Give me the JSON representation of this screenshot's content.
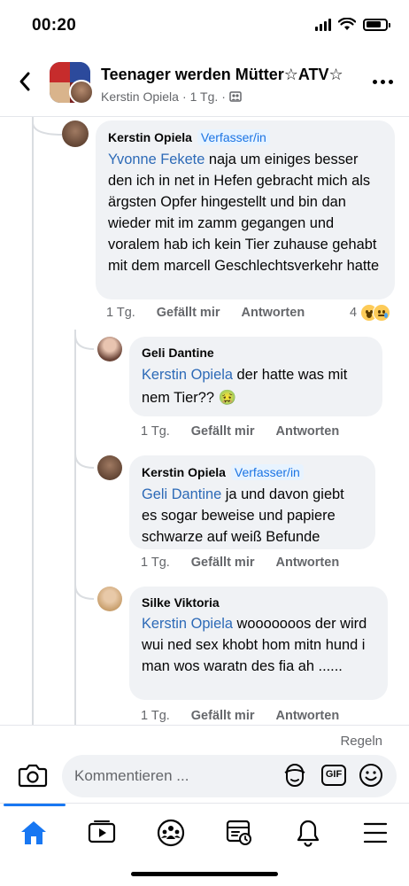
{
  "status_bar": {
    "time": "00:20"
  },
  "header": {
    "group_title": "Teenager werden Mütter☆ATV☆",
    "poster_name": "Kerstin Opiela",
    "post_age": "1 Tg."
  },
  "comments": [
    {
      "author": "Kerstin Opiela",
      "badge": "Verfasser/in",
      "mention": "Yvonne Fekete",
      "text": " naja um einiges besser den ich in net in Hefen gebracht mich als ärgsten Opfer hingestellt und bin dan wieder mit im zamm gegangen und voralem hab ich kein Tier zuhause gehabt mit dem marcell Geschlechtsverkehr hatte",
      "time": "1 Tg.",
      "like": "Gefällt mir",
      "reply": "Antworten",
      "reaction_count": "4",
      "reaction_icons": [
        "wow-reaction-icon",
        "sad-reaction-icon"
      ]
    },
    {
      "author": "Geli Dantine",
      "mention": "Kerstin Opiela",
      "text": " der hatte was mit nem Tier?? 🤢",
      "time": "1 Tg.",
      "like": "Gefällt mir",
      "reply": "Antworten"
    },
    {
      "author": "Kerstin Opiela",
      "badge": "Verfasser/in",
      "mention": "Geli Dantine",
      "text": " ja und davon giebt es sogar beweise und papiere schwarze auf weiß Befunde",
      "time": "1 Tg.",
      "like": "Gefällt mir",
      "reply": "Antworten"
    },
    {
      "author": "Silke Viktoria",
      "mention": "Kerstin Opiela",
      "text": " wooooooos der wird wui ned sex khobt hom mitn hund i man wos waratn des fia ah ......",
      "time": "1 Tg.",
      "like": "Gefällt mir",
      "reply": "Antworten"
    }
  ],
  "footer": {
    "rules_label": "Regeln",
    "comment_placeholder": "Kommentieren ...",
    "gif_label": "GIF"
  },
  "tabs": [
    "home-icon",
    "video-icon",
    "groups-icon",
    "feeds-icon",
    "notifications-icon",
    "menu-icon"
  ],
  "colors": {
    "accent": "#1877f2",
    "mention": "#2d6ab7",
    "bubble": "#f0f2f5",
    "muted": "#65676b"
  }
}
